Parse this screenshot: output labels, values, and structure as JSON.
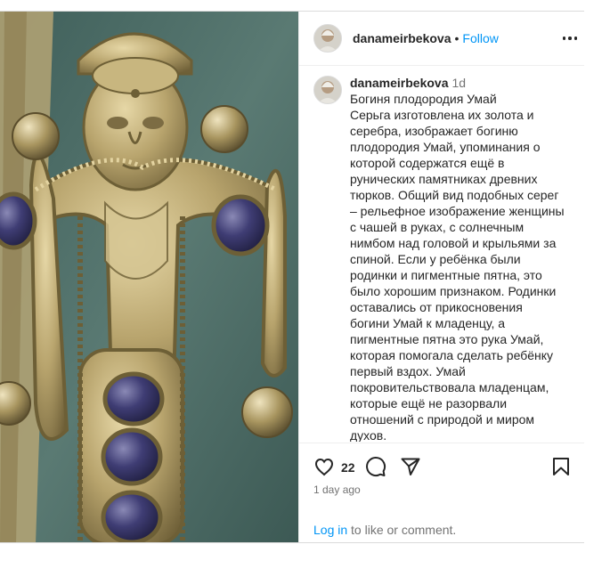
{
  "header": {
    "username": "danameirbekova",
    "separator": "•",
    "follow_label": "Follow"
  },
  "caption": {
    "username": "danameirbekova",
    "time": "1d",
    "lines": [
      "Богиня плодородия Умай",
      "Серьга изготовлена их золота и",
      "серебра, изображает богиню",
      "плодородия Умай, упоминания о",
      "которой содержатся ещё в",
      "рунических памятниках древних",
      "тюрков. Общий вид подобных серег",
      "– рельефное изображение женщины",
      "с чашей в руках, с солнечным",
      "нимбом над головой и крыльями за",
      "спиной. Если у ребёнка были",
      "родинки и пигментные пятна, это",
      "было хорошим признаком. Родинки",
      "оставались от прикосновения",
      "богини Умай к младенцу, а",
      "пигментные пятна это рука Умай,",
      "которая помогала сделать ребёнку",
      "первый вздох. Умай",
      "покровительствовала младенцам,",
      "которые ещё не разорвали",
      "отношений с природой и миром",
      "духов."
    ]
  },
  "actions": {
    "like_icon": "heart-icon",
    "comment_icon": "comment-icon",
    "share_icon": "paper-plane-icon",
    "save_icon": "bookmark-icon",
    "likes_count": "22"
  },
  "date": "1 day ago",
  "login": {
    "link_label": "Log in",
    "suffix": " to like or comment."
  },
  "colors": {
    "link": "#0095f6",
    "text": "#262626",
    "secondary": "#737373",
    "border": "#dbdbdb"
  }
}
